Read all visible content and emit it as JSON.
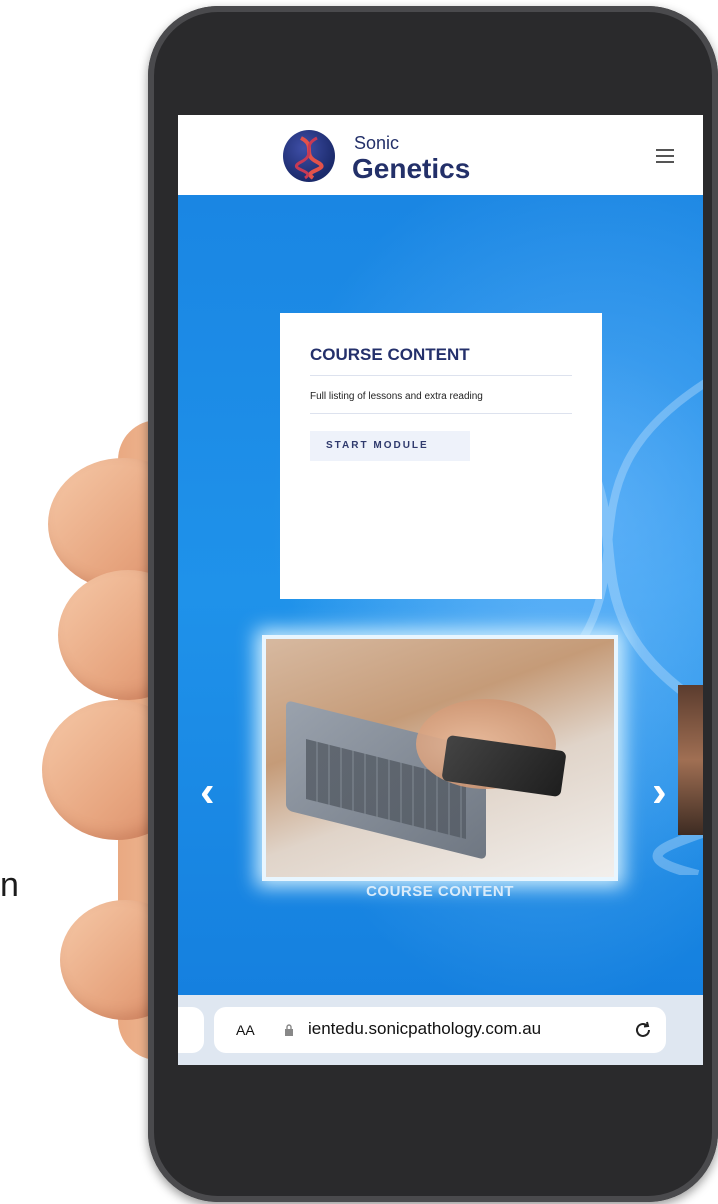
{
  "stray_text": "n",
  "header": {
    "brand_small": "Sonic",
    "brand_large": "Genetics",
    "menu_icon": "hamburger-menu-icon"
  },
  "card": {
    "title": "COURSE CONTENT",
    "description": "Full listing of lessons and extra reading",
    "button_label": "START MODULE"
  },
  "carousel": {
    "caption": "COURSE CONTENT",
    "prev_icon": "chevron-left-icon",
    "next_icon": "chevron-right-icon"
  },
  "browser": {
    "text_size_label": "AA",
    "url": "ientedu.sonicpathology.com.au",
    "lock_icon": "lock-icon",
    "reload_icon": "reload-icon"
  },
  "colors": {
    "brand_navy": "#233069",
    "hero_blue": "#1f8fe6",
    "card_bg": "#ffffff"
  }
}
